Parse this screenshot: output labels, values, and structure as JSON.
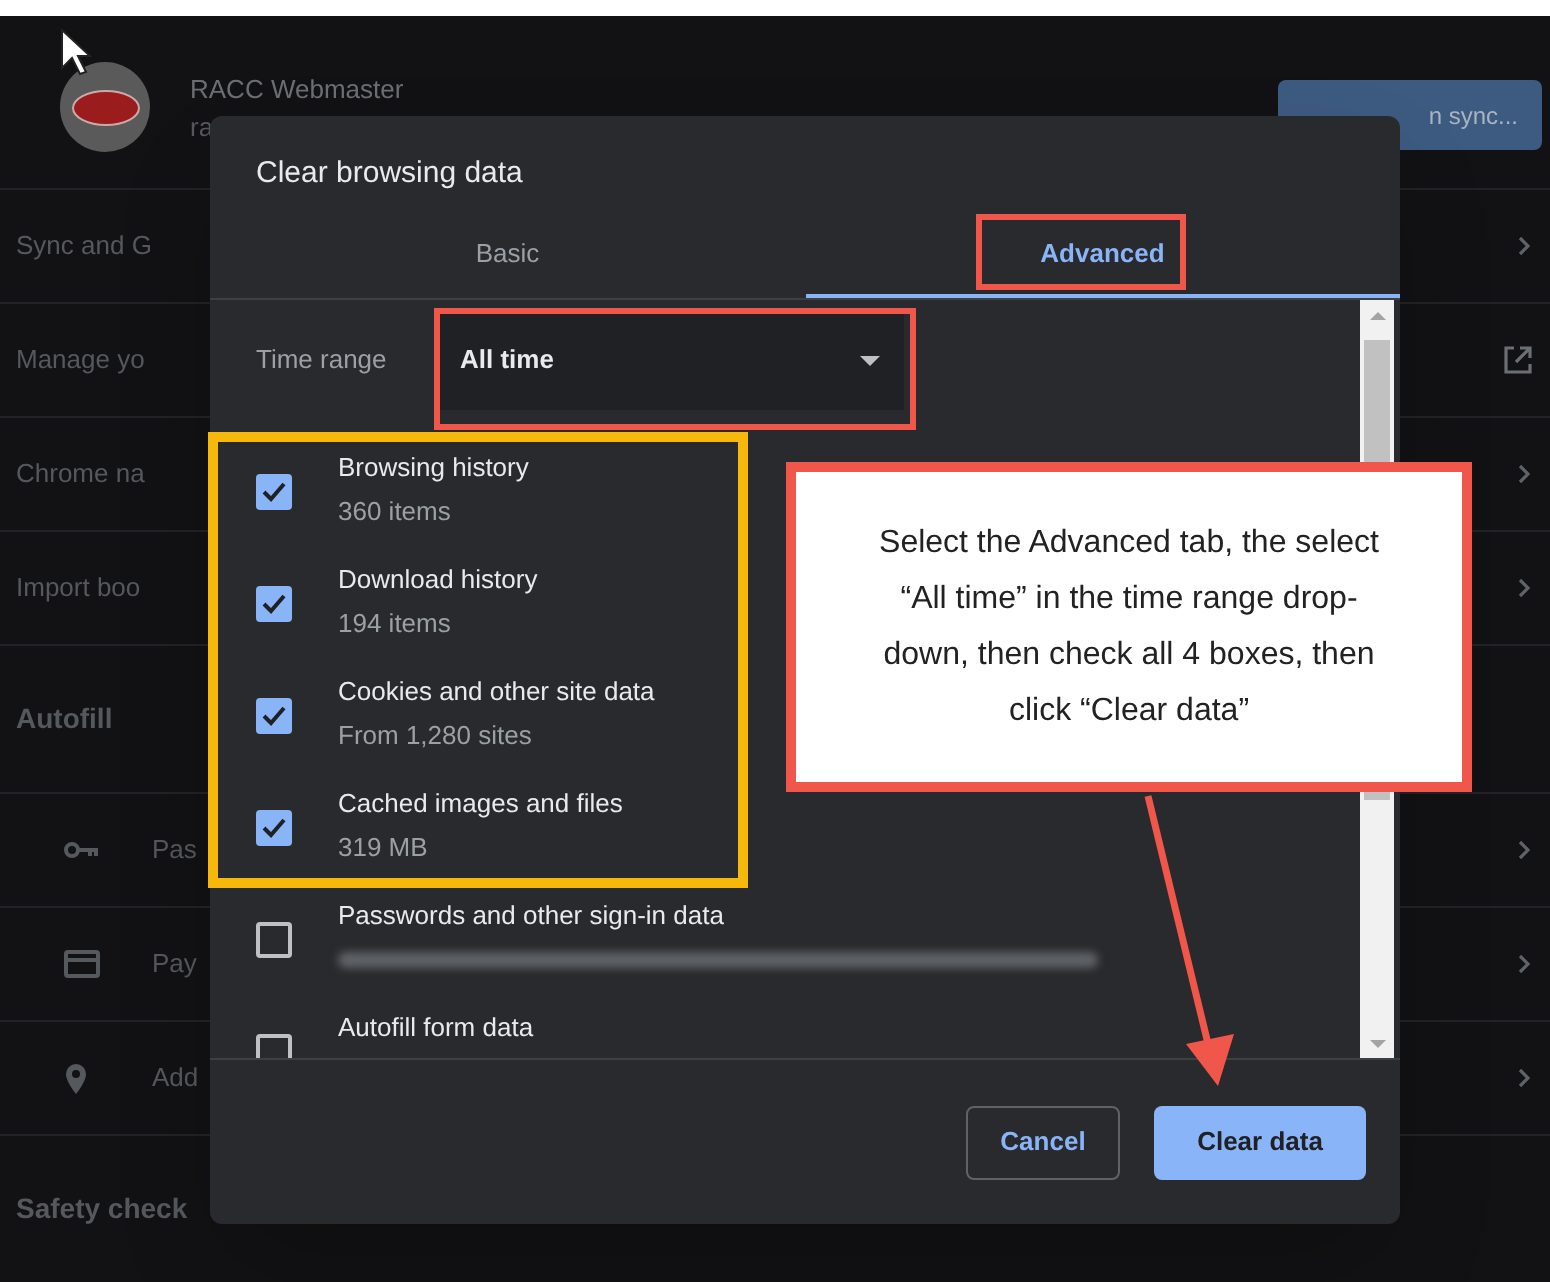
{
  "settings": {
    "profile_name": "RACC Webmaster",
    "profile_email": "ra",
    "sync_button": "n sync...",
    "rows": [
      {
        "label": "Sync and G",
        "kind": "chevron"
      },
      {
        "label": "Manage yo",
        "kind": "external"
      },
      {
        "label": "Chrome na",
        "kind": "chevron"
      },
      {
        "label": "Import boo",
        "kind": "chevron"
      }
    ],
    "autofill_heading": "Autofill",
    "autofill_rows": [
      {
        "label": "Pas",
        "kind": "key"
      },
      {
        "label": "Pay",
        "kind": "card"
      },
      {
        "label": "Add",
        "kind": "pin"
      }
    ],
    "safety_heading": "Safety check"
  },
  "dialog": {
    "title": "Clear browsing data",
    "tabs": [
      {
        "label": "Basic",
        "selected": false
      },
      {
        "label": "Advanced",
        "selected": true
      }
    ],
    "time_range": {
      "label": "Time range",
      "value": "All time"
    },
    "options": [
      {
        "title": "Browsing history",
        "detail": "360 items",
        "checked": true
      },
      {
        "title": "Download history",
        "detail": "194 items",
        "checked": true
      },
      {
        "title": "Cookies and other site data",
        "detail": "From 1,280 sites",
        "checked": true
      },
      {
        "title": "Cached images and files",
        "detail": "319 MB",
        "checked": true
      },
      {
        "title": "Passwords and other sign-in data",
        "detail_redacted": true,
        "checked": false
      },
      {
        "title": "Autofill form data",
        "checked": false
      }
    ],
    "buttons": {
      "cancel": "Cancel",
      "confirm": "Clear data"
    }
  },
  "callout": {
    "text": "Select the Advanced tab, the select “All time” in the time range drop-down, then check all 4 boxes, then click “Clear data”"
  }
}
